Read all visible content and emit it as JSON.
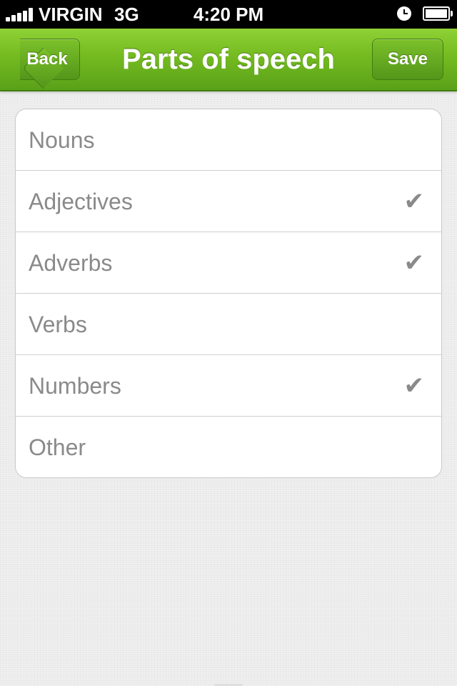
{
  "status_bar": {
    "carrier": "VIRGIN",
    "network": "3G",
    "time": "4:20 PM",
    "signal_icon": "signal-bars-icon",
    "alarm_icon": "alarm-clock-icon",
    "battery_icon": "battery-icon"
  },
  "nav_bar": {
    "title": "Parts of speech",
    "back_label": "Back",
    "save_label": "Save",
    "color": "#74bb20"
  },
  "list": {
    "items": [
      {
        "label": "Nouns",
        "checked": false
      },
      {
        "label": "Adjectives",
        "checked": true
      },
      {
        "label": "Adverbs",
        "checked": true
      },
      {
        "label": "Verbs",
        "checked": false
      },
      {
        "label": "Numbers",
        "checked": true
      },
      {
        "label": "Other",
        "checked": false
      }
    ],
    "check_glyph": "✔",
    "check_icon": "checkmark-icon",
    "text_color": "#8a8a8a"
  }
}
